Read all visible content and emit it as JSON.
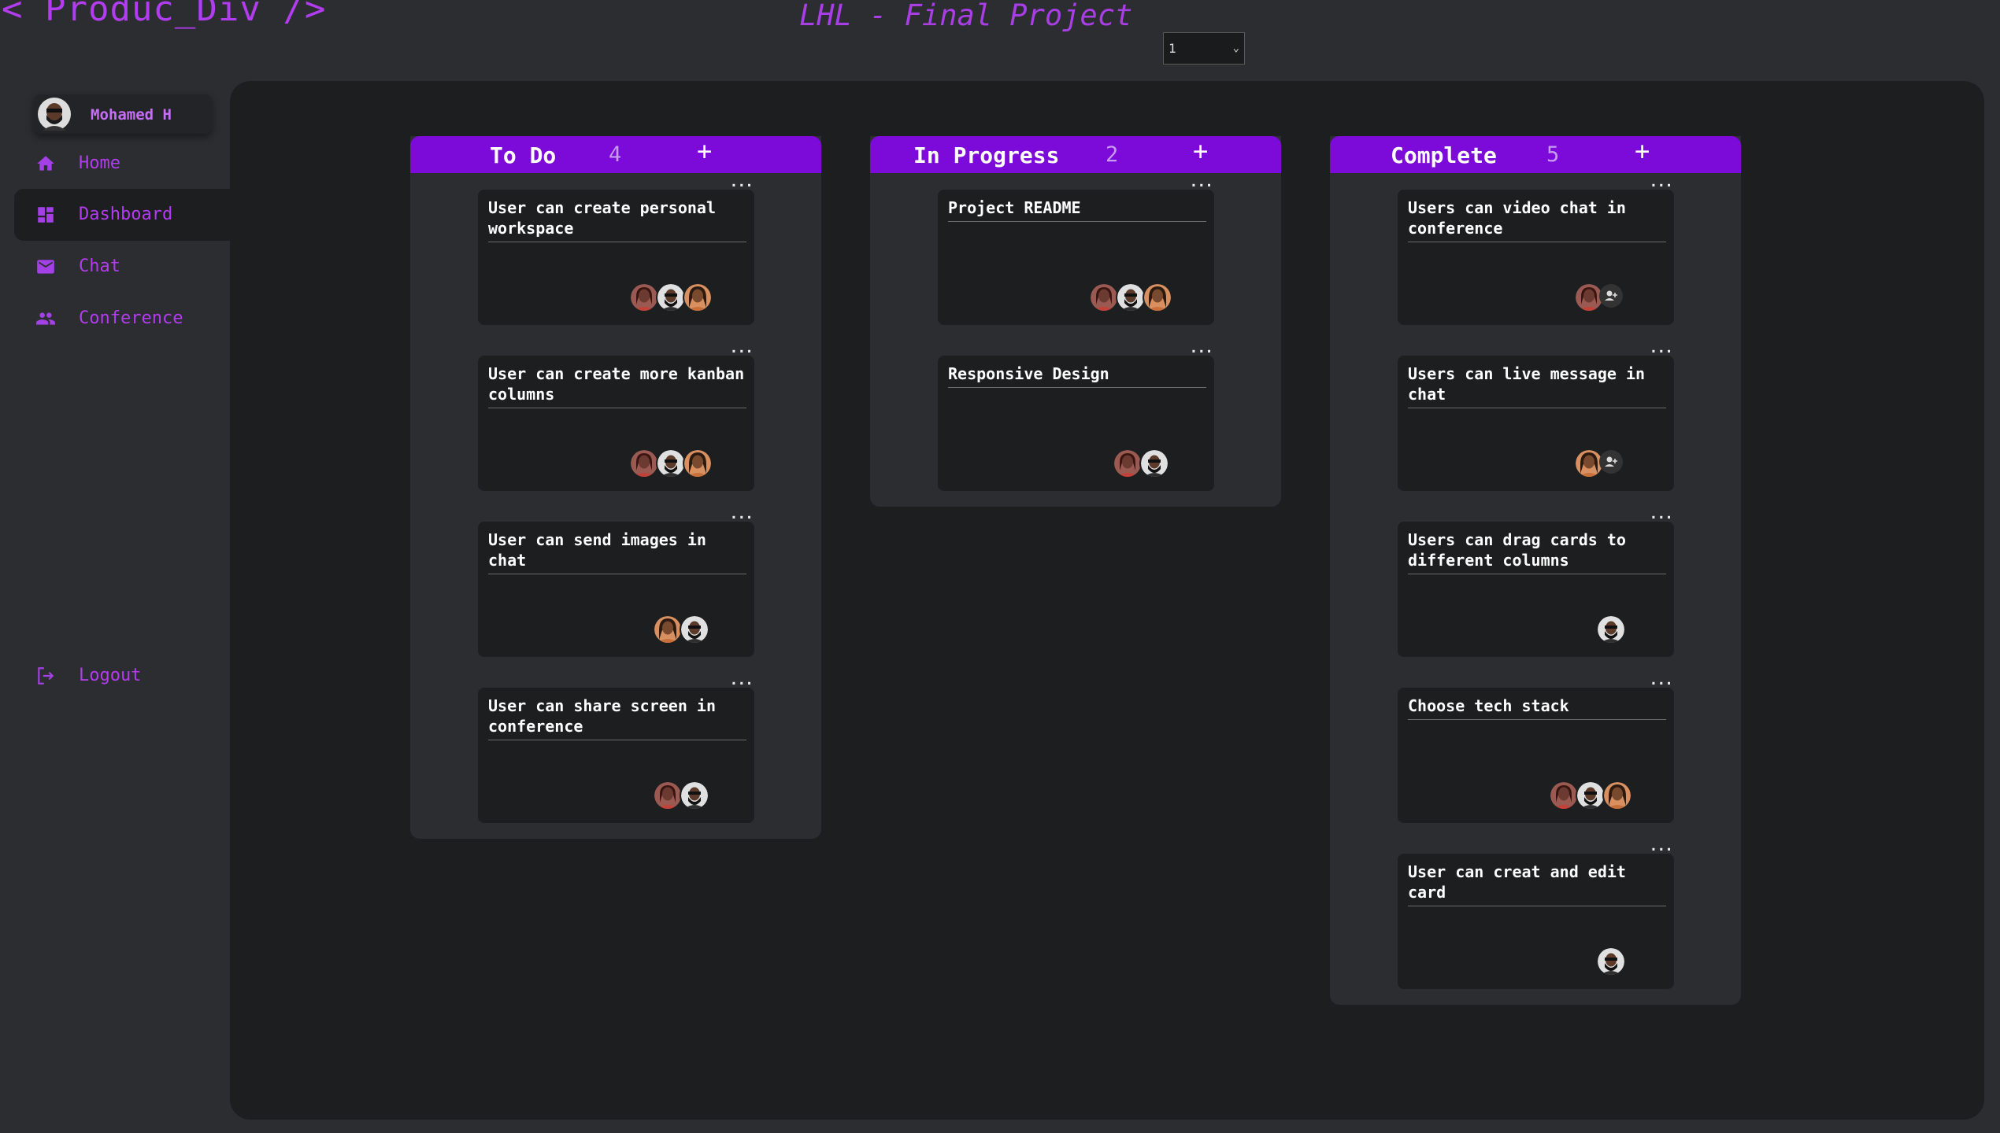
{
  "app": {
    "logo": "< Produc_Div />",
    "project_title": "LHL - Final Project",
    "sprint_select_value": "1"
  },
  "user": {
    "name": "Mohamed H"
  },
  "nav": {
    "items": [
      {
        "label": "Home",
        "icon": "home-icon"
      },
      {
        "label": "Dashboard",
        "icon": "dashboard-icon",
        "active": true
      },
      {
        "label": "Chat",
        "icon": "mail-icon"
      },
      {
        "label": "Conference",
        "icon": "people-icon"
      }
    ],
    "logout": {
      "label": "Logout",
      "icon": "logout-icon"
    }
  },
  "colors": {
    "accent": "#7c0ad8",
    "accent_text": "#b33cf0",
    "board_bg": "#1d1e20",
    "column_bg": "#2b2d30"
  },
  "columns": [
    {
      "title": "To Do",
      "count": "4",
      "add_label": "+",
      "cards": [
        {
          "title": "User can create personal workspace",
          "menu": "...",
          "avatars": [
            "red",
            "beard",
            "orange"
          ]
        },
        {
          "title": "User can create more kanban columns",
          "menu": "...",
          "avatars": [
            "red",
            "beard",
            "orange"
          ]
        },
        {
          "title": "User can send images in chat",
          "menu": "...",
          "avatars": [
            "orange",
            "beard"
          ]
        },
        {
          "title": "User can share screen in conference",
          "menu": "...",
          "avatars": [
            "red",
            "beard"
          ]
        }
      ]
    },
    {
      "title": "In Progress",
      "count": "2",
      "add_label": "+",
      "cards": [
        {
          "title": "Project README",
          "menu": "...",
          "avatars": [
            "red",
            "beard",
            "orange"
          ]
        },
        {
          "title": "Responsive Design",
          "menu": "...",
          "avatars": [
            "red",
            "beard"
          ]
        }
      ]
    },
    {
      "title": "Complete",
      "count": "5",
      "add_label": "+",
      "cards": [
        {
          "title": "Users can video chat in conference",
          "menu": "...",
          "avatars": [
            "red",
            "add"
          ]
        },
        {
          "title": "Users can live message in chat",
          "menu": "...",
          "avatars": [
            "orange",
            "add"
          ]
        },
        {
          "title": "Users can drag cards to different columns",
          "menu": "...",
          "avatars": [
            "beard"
          ]
        },
        {
          "title": "Choose tech stack",
          "menu": "...",
          "avatars": [
            "red",
            "beard",
            "orange"
          ]
        },
        {
          "title": "User can creat and edit card",
          "menu": "...",
          "avatars": [
            "beard"
          ]
        }
      ]
    }
  ]
}
